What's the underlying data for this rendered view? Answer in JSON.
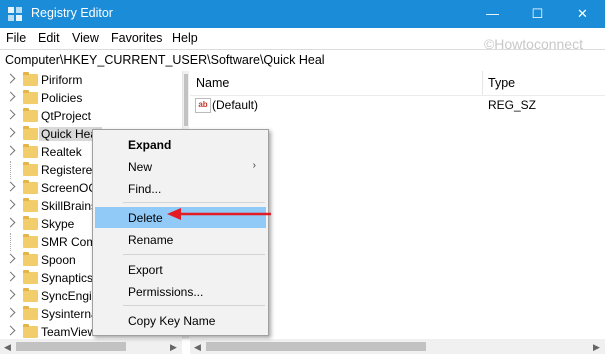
{
  "window": {
    "title": "Registry Editor",
    "minimize_glyph": "—",
    "maximize_glyph": "☐",
    "close_glyph": "✕"
  },
  "menu": [
    "File",
    "Edit",
    "View",
    "Favorites",
    "Help"
  ],
  "watermark": "©Howtoconnect",
  "address": "Computer\\HKEY_CURRENT_USER\\Software\\Quick Heal",
  "tree": [
    {
      "label": "Piriform",
      "expander": true
    },
    {
      "label": "Policies",
      "expander": true
    },
    {
      "label": "QtProject",
      "expander": true
    },
    {
      "label": "Quick Heal",
      "expander": true,
      "selected": true
    },
    {
      "label": "Realtek",
      "expander": true
    },
    {
      "label": "Registered",
      "expander": false
    },
    {
      "label": "ScreenOC",
      "expander": true
    },
    {
      "label": "SkillBrains",
      "expander": true
    },
    {
      "label": "Skype",
      "expander": true
    },
    {
      "label": "SMR Com",
      "expander": false
    },
    {
      "label": "Spoon",
      "expander": true
    },
    {
      "label": "Synaptics",
      "expander": true
    },
    {
      "label": "SyncEngin",
      "expander": true
    },
    {
      "label": "Sysinterna",
      "expander": true
    },
    {
      "label": "TeamViewer",
      "expander": true
    }
  ],
  "values_pane": {
    "columns": {
      "name": "Name",
      "type": "Type"
    },
    "rows": [
      {
        "icon": "ab",
        "name": "(Default)",
        "type": "REG_SZ"
      }
    ]
  },
  "context_menu": {
    "items": [
      {
        "label": "Expand",
        "bold": true
      },
      {
        "label": "New",
        "submenu": true
      },
      {
        "label": "Find..."
      },
      {
        "label": "Delete",
        "highlighted": true
      },
      {
        "label": "Rename"
      },
      {
        "label": "Export"
      },
      {
        "label": "Permissions..."
      },
      {
        "label": "Copy Key Name"
      }
    ],
    "submenu_glyph": "›"
  },
  "colors": {
    "titlebar": "#1a8cd8",
    "highlight": "#91c9f7",
    "annotation_arrow": "#e31b23"
  },
  "scroll_glyphs": {
    "left": "◀",
    "right": "▶"
  }
}
